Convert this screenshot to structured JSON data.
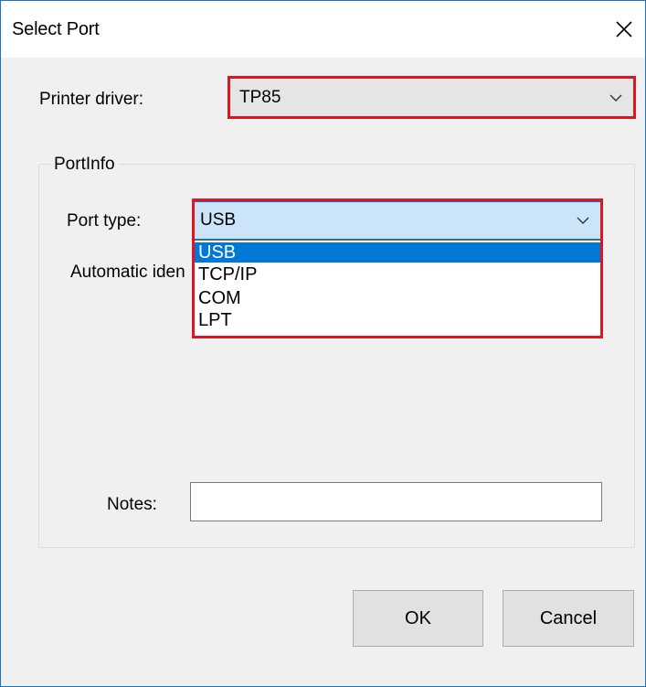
{
  "window": {
    "title": "Select Port",
    "close_icon": "close-icon"
  },
  "printer_driver": {
    "label": "Printer driver:",
    "value": "TP85"
  },
  "port_info": {
    "caption": "PortInfo",
    "port_type": {
      "label": "Port type:",
      "value": "USB",
      "options": [
        "USB",
        "TCP/IP",
        "COM",
        "LPT"
      ],
      "selected_index": 0
    },
    "automatic_label": "Automatic iden",
    "notes": {
      "label": "Notes:",
      "value": ""
    }
  },
  "buttons": {
    "ok": "OK",
    "cancel": "Cancel"
  },
  "colors": {
    "highlight_frame": "#e0161e",
    "selection": "#0078d7",
    "window_border": "#1c75bc"
  }
}
